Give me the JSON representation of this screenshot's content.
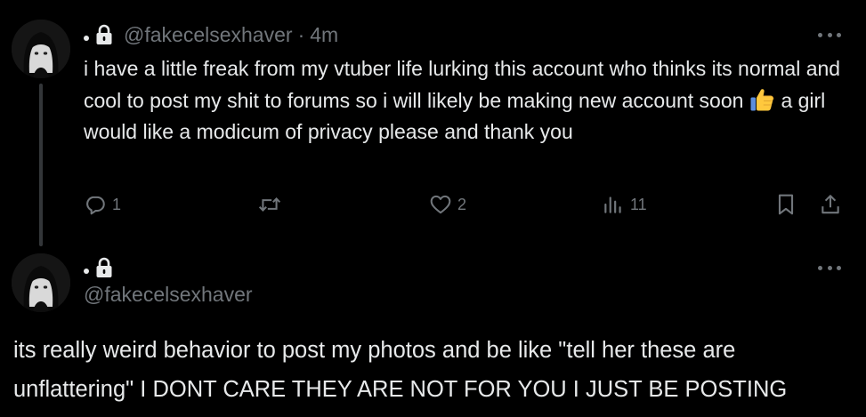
{
  "colors": {
    "background": "#000000",
    "text_primary": "#e7e9ea",
    "text_secondary": "#71767b",
    "thread_line": "#333639"
  },
  "post_1": {
    "display_name": "",
    "handle": "@fakecelsexhaver",
    "separator": "·",
    "time": "4m",
    "text_before_emoji": "i have a little freak from my vtuber life lurking this account who thinks its normal and cool to post my shit to forums so i will likely be making new account soon",
    "emoji": "thumbs-up",
    "text_after_emoji": "a girl would like a modicum of privacy please and thank you",
    "actions": {
      "replies": "1",
      "reposts": "",
      "likes": "2",
      "views": "11"
    },
    "icons": [
      "lock-icon",
      "more-icon",
      "reply-icon",
      "repost-icon",
      "like-icon",
      "views-icon",
      "bookmark-icon",
      "share-icon"
    ]
  },
  "post_2": {
    "display_name": "",
    "handle": "@fakecelsexhaver",
    "text": "its really weird behavior to post my photos and be like \"tell her these are unflattering\" I DONT CARE THEY ARE NOT FOR YOU I JUST BE POSTING",
    "icons": [
      "lock-icon",
      "more-icon"
    ]
  }
}
